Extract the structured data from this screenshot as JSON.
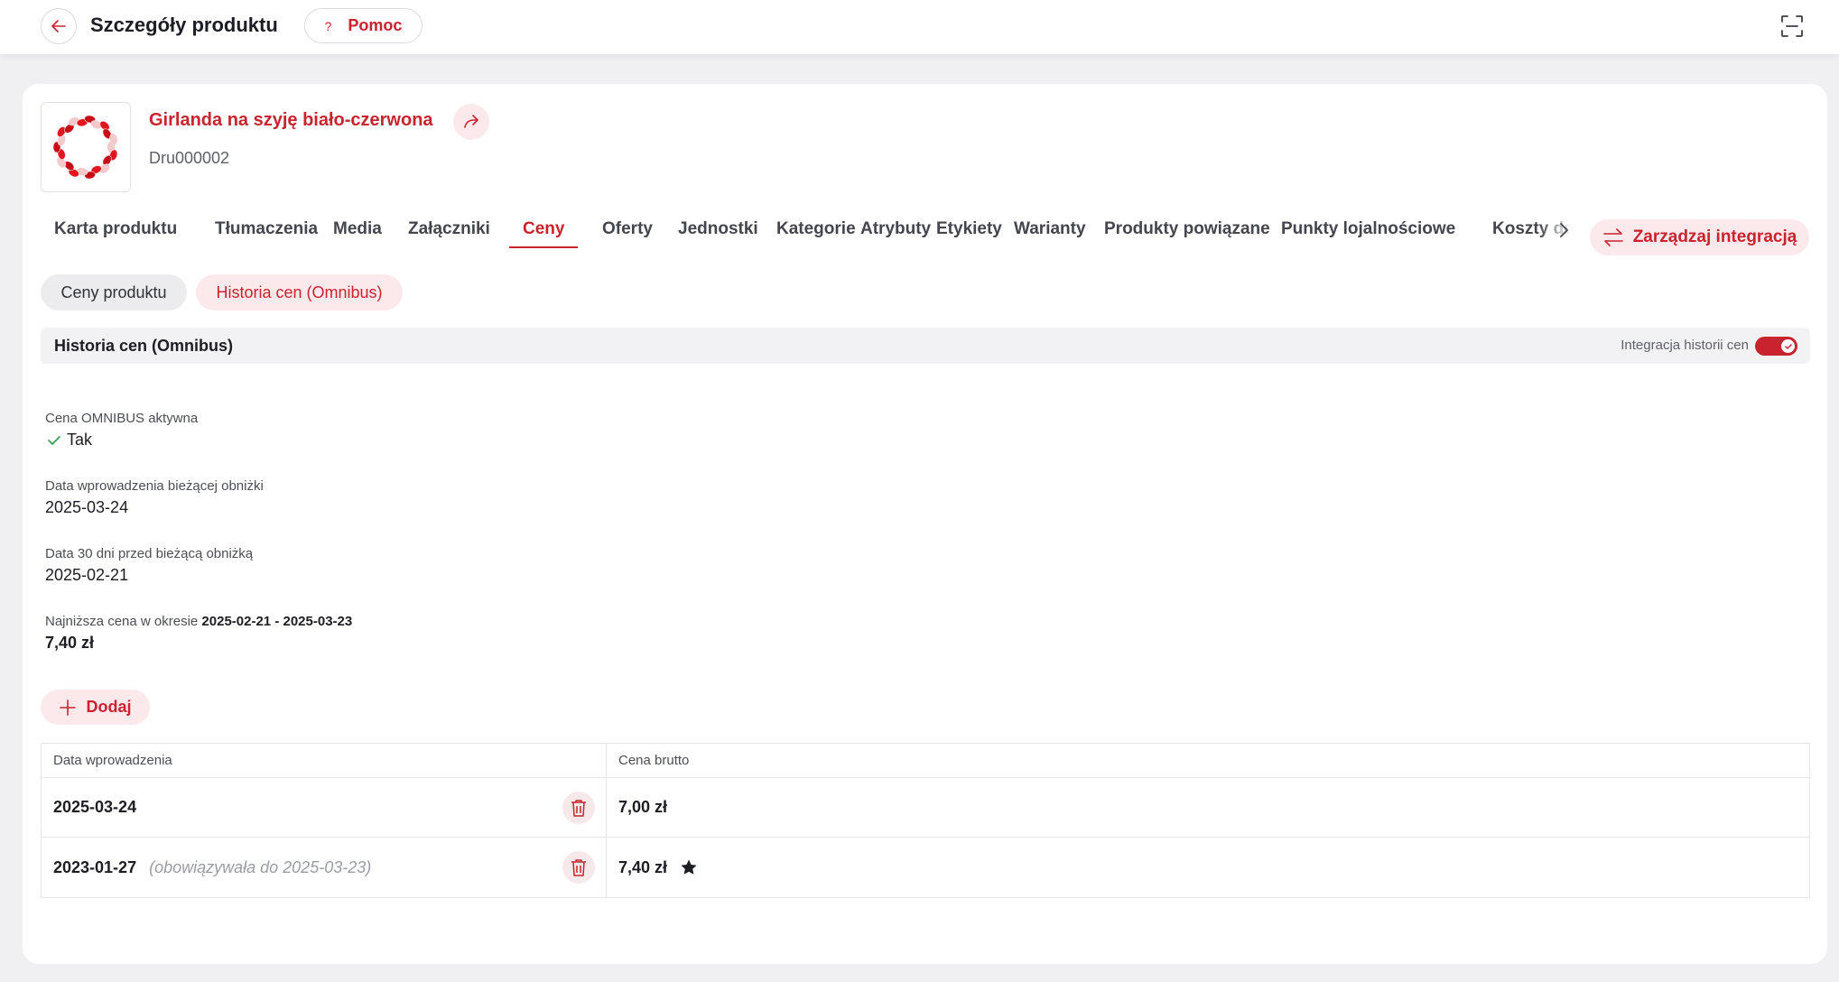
{
  "header": {
    "title": "Szczegóły produktu",
    "help_label": "Pomoc",
    "help_icon_char": "?"
  },
  "product": {
    "name": "Girlanda na szyję biało-czerwona",
    "code": "Dru000002"
  },
  "tabs": [
    {
      "label": "Karta produktu"
    },
    {
      "label": "Tłumaczenia"
    },
    {
      "label": "Media"
    },
    {
      "label": "Załączniki"
    },
    {
      "label": "Ceny",
      "active": true
    },
    {
      "label": "Oferty"
    },
    {
      "label": "Jednostki"
    },
    {
      "label": "Kategorie"
    },
    {
      "label": "Atrybuty"
    },
    {
      "label": "Etykiety"
    },
    {
      "label": "Warianty"
    },
    {
      "label": "Produkty powiązane"
    },
    {
      "label": "Punkty lojalnościowe"
    },
    {
      "label": "Koszty dostawy"
    }
  ],
  "manage_integration_label": "Zarządzaj integracją",
  "subtabs": [
    {
      "label": "Ceny produktu"
    },
    {
      "label": "Historia cen (Omnibus)",
      "active": true
    }
  ],
  "section": {
    "title": "Historia cen (Omnibus)",
    "toggle_label": "Integracja historii cen",
    "toggle_on": true
  },
  "fields": {
    "omnibus_active_label": "Cena OMNIBUS aktywna",
    "omnibus_active_value": "Tak",
    "current_discount_date_label": "Data wprowadzenia bieżącej obniżki",
    "current_discount_date_value": "2025-03-24",
    "date_30_days_label": "Data 30 dni przed bieżącą obniżką",
    "date_30_days_value": "2025-02-21",
    "lowest_price_label": "Najniższa cena w okresie",
    "lowest_price_period_from": "2025-02-21",
    "lowest_price_period_sep": "-",
    "lowest_price_period_to": "2025-03-23",
    "lowest_price_value": "7,40 zł"
  },
  "add_label": "Dodaj",
  "table": {
    "headers": [
      "Data wprowadzenia",
      "Cena brutto"
    ],
    "rows": [
      {
        "date": "2025-03-24",
        "valid_until": "",
        "price": "7,00 zł",
        "starred": false
      },
      {
        "date": "2023-01-27",
        "valid_until": "(obowiązywała do 2025-03-23)",
        "price": "7,40 zł",
        "starred": true
      }
    ]
  },
  "colors": {
    "accent": "#c8232f",
    "accent_light": "#fbe9eb",
    "check_green": "#2e9b4e"
  },
  "icons": {
    "back": "arrow-left-icon",
    "fullscreen": "fullscreen-icon",
    "share": "share-icon",
    "chevron": "chevron-right-icon",
    "manage": "swap-arrows-icon",
    "add": "plus-icon",
    "delete": "trash-icon",
    "star": "star-icon",
    "check": "check-icon"
  }
}
